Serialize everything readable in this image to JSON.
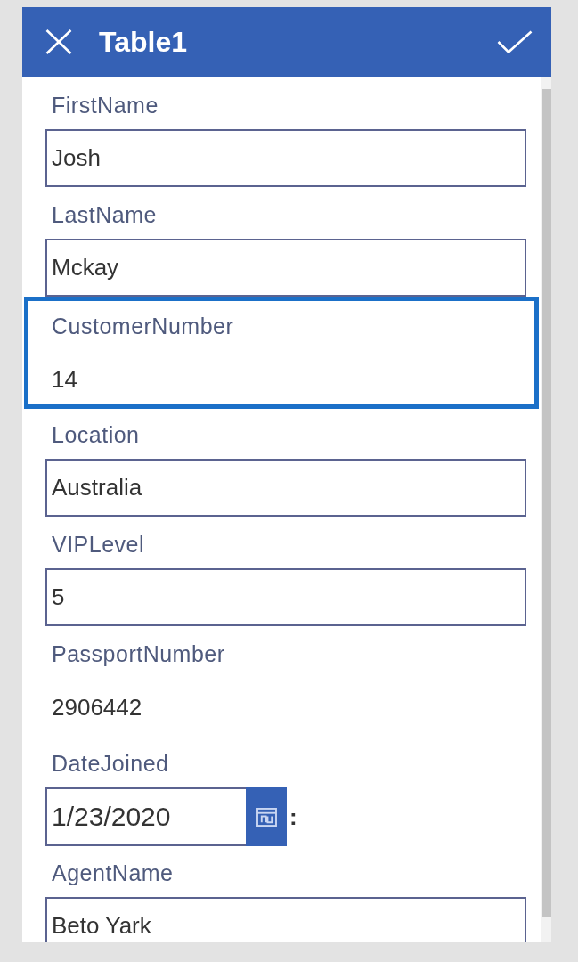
{
  "header": {
    "title": "Table1"
  },
  "fields": [
    {
      "label": "FirstName",
      "kind": "text",
      "value": "Josh",
      "selected": false
    },
    {
      "label": "LastName",
      "kind": "text",
      "value": "Mckay",
      "selected": false
    },
    {
      "label": "CustomerNumber",
      "kind": "readonly",
      "value": "14",
      "selected": true
    },
    {
      "label": "Location",
      "kind": "text",
      "value": "Australia",
      "selected": false
    },
    {
      "label": "VIPLevel",
      "kind": "text",
      "value": "5",
      "selected": false
    },
    {
      "label": "PassportNumber",
      "kind": "readonly",
      "value": "2906442",
      "selected": false
    },
    {
      "label": "DateJoined",
      "kind": "date",
      "value": "1/23/2020",
      "separator": ":",
      "selected": false
    },
    {
      "label": "AgentName",
      "kind": "text",
      "value": "Beto Yark",
      "selected": false
    }
  ]
}
